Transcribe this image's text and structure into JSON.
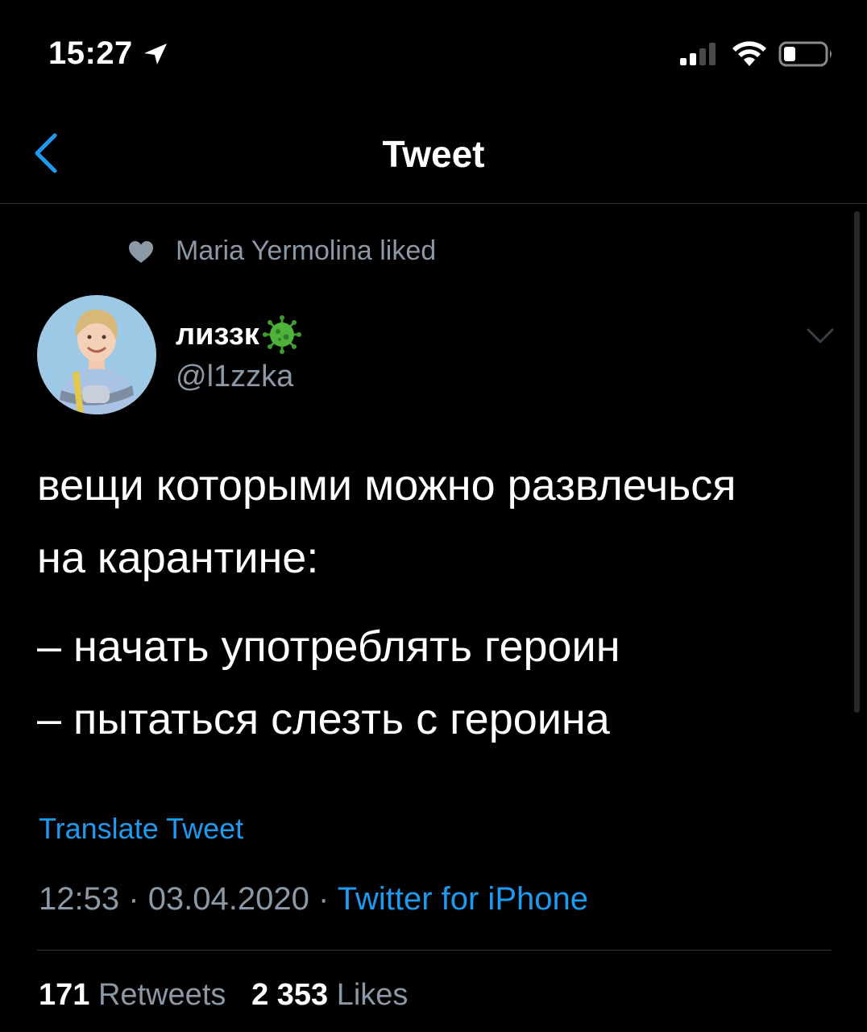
{
  "status_bar": {
    "time": "15:27"
  },
  "nav": {
    "title": "Tweet"
  },
  "social_context": {
    "text": "Maria Yermolina liked"
  },
  "author": {
    "display_name": "лиззк",
    "handle": "@l1zzka"
  },
  "tweet": {
    "lines": [
      "вещи которыми можно развлечься",
      "на карантине:",
      "– начать употреблять героин",
      "– пытаться слезть с героина"
    ],
    "translate_label": "Translate Tweet",
    "time": "12:53",
    "date": "03.04.2020",
    "separator": "·",
    "source": "Twitter for iPhone"
  },
  "stats": {
    "retweets_count": "171",
    "retweets_label": "Retweets",
    "likes_count": "2 353",
    "likes_label": "Likes"
  },
  "colors": {
    "background": "#000000",
    "accent": "#1d9bf0",
    "secondary_text": "#8b98a5",
    "divider": "#2f3336"
  }
}
